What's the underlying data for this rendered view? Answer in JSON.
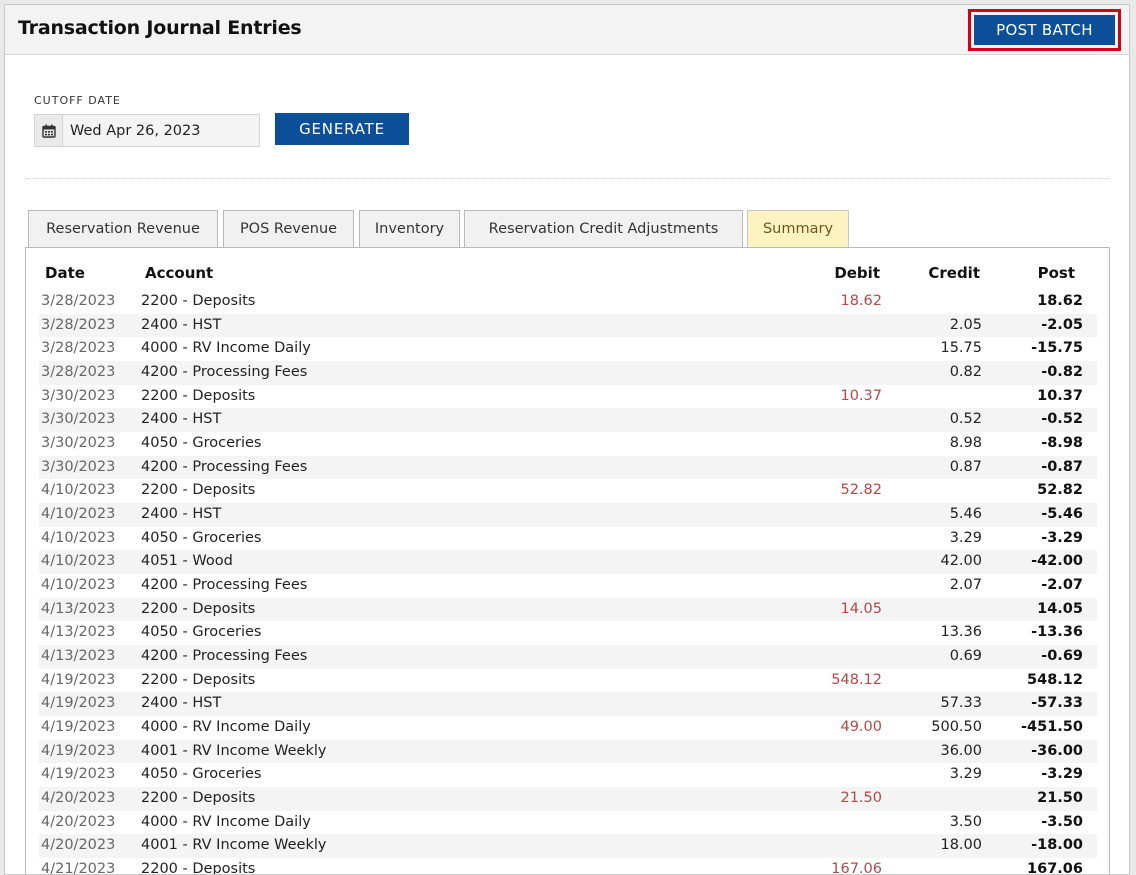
{
  "header": {
    "title": "Transaction Journal Entries",
    "post_batch_label": "POST BATCH"
  },
  "filters": {
    "cutoff_label": "CUTOFF DATE",
    "cutoff_value": "Wed Apr 26, 2023",
    "generate_label": "GENERATE",
    "calendar_icon": "calendar-icon"
  },
  "tabs": [
    {
      "label": "Reservation Revenue",
      "active": false
    },
    {
      "label": "POS Revenue",
      "active": false
    },
    {
      "label": "Inventory",
      "active": false
    },
    {
      "label": "Reservation Credit Adjustments",
      "active": false
    },
    {
      "label": "Summary",
      "active": true
    }
  ],
  "table": {
    "columns": {
      "date": "Date",
      "account": "Account",
      "debit": "Debit",
      "credit": "Credit",
      "post": "Post"
    },
    "rows": [
      {
        "date": "3/28/2023",
        "account": "2200 - Deposits",
        "debit": "18.62",
        "credit": "",
        "post": "18.62"
      },
      {
        "date": "3/28/2023",
        "account": "2400 - HST",
        "debit": "",
        "credit": "2.05",
        "post": "-2.05"
      },
      {
        "date": "3/28/2023",
        "account": "4000 - RV Income Daily",
        "debit": "",
        "credit": "15.75",
        "post": "-15.75"
      },
      {
        "date": "3/28/2023",
        "account": "4200 - Processing Fees",
        "debit": "",
        "credit": "0.82",
        "post": "-0.82"
      },
      {
        "date": "3/30/2023",
        "account": "2200 - Deposits",
        "debit": "10.37",
        "credit": "",
        "post": "10.37"
      },
      {
        "date": "3/30/2023",
        "account": "2400 - HST",
        "debit": "",
        "credit": "0.52",
        "post": "-0.52"
      },
      {
        "date": "3/30/2023",
        "account": "4050 - Groceries",
        "debit": "",
        "credit": "8.98",
        "post": "-8.98"
      },
      {
        "date": "3/30/2023",
        "account": "4200 - Processing Fees",
        "debit": "",
        "credit": "0.87",
        "post": "-0.87"
      },
      {
        "date": "4/10/2023",
        "account": "2200 - Deposits",
        "debit": "52.82",
        "credit": "",
        "post": "52.82"
      },
      {
        "date": "4/10/2023",
        "account": "2400 - HST",
        "debit": "",
        "credit": "5.46",
        "post": "-5.46"
      },
      {
        "date": "4/10/2023",
        "account": "4050 - Groceries",
        "debit": "",
        "credit": "3.29",
        "post": "-3.29"
      },
      {
        "date": "4/10/2023",
        "account": "4051 - Wood",
        "debit": "",
        "credit": "42.00",
        "post": "-42.00"
      },
      {
        "date": "4/10/2023",
        "account": "4200 - Processing Fees",
        "debit": "",
        "credit": "2.07",
        "post": "-2.07"
      },
      {
        "date": "4/13/2023",
        "account": "2200 - Deposits",
        "debit": "14.05",
        "credit": "",
        "post": "14.05"
      },
      {
        "date": "4/13/2023",
        "account": "4050 - Groceries",
        "debit": "",
        "credit": "13.36",
        "post": "-13.36"
      },
      {
        "date": "4/13/2023",
        "account": "4200 - Processing Fees",
        "debit": "",
        "credit": "0.69",
        "post": "-0.69"
      },
      {
        "date": "4/19/2023",
        "account": "2200 - Deposits",
        "debit": "548.12",
        "credit": "",
        "post": "548.12"
      },
      {
        "date": "4/19/2023",
        "account": "2400 - HST",
        "debit": "",
        "credit": "57.33",
        "post": "-57.33"
      },
      {
        "date": "4/19/2023",
        "account": "4000 - RV Income Daily",
        "debit": "49.00",
        "credit": "500.50",
        "post": "-451.50"
      },
      {
        "date": "4/19/2023",
        "account": "4001 - RV Income Weekly",
        "debit": "",
        "credit": "36.00",
        "post": "-36.00"
      },
      {
        "date": "4/19/2023",
        "account": "4050 - Groceries",
        "debit": "",
        "credit": "3.29",
        "post": "-3.29"
      },
      {
        "date": "4/20/2023",
        "account": "2200 - Deposits",
        "debit": "21.50",
        "credit": "",
        "post": "21.50"
      },
      {
        "date": "4/20/2023",
        "account": "4000 - RV Income Daily",
        "debit": "",
        "credit": "3.50",
        "post": "-3.50"
      },
      {
        "date": "4/20/2023",
        "account": "4001 - RV Income Weekly",
        "debit": "",
        "credit": "18.00",
        "post": "-18.00"
      },
      {
        "date": "4/21/2023",
        "account": "2200 - Deposits",
        "debit": "167.06",
        "credit": "",
        "post": "167.06"
      }
    ]
  },
  "colors": {
    "primary_button": "#0b4f98",
    "highlight_border": "#d0021b",
    "active_tab_bg": "#fdf3c1",
    "debit_text": "#b04a4a"
  }
}
